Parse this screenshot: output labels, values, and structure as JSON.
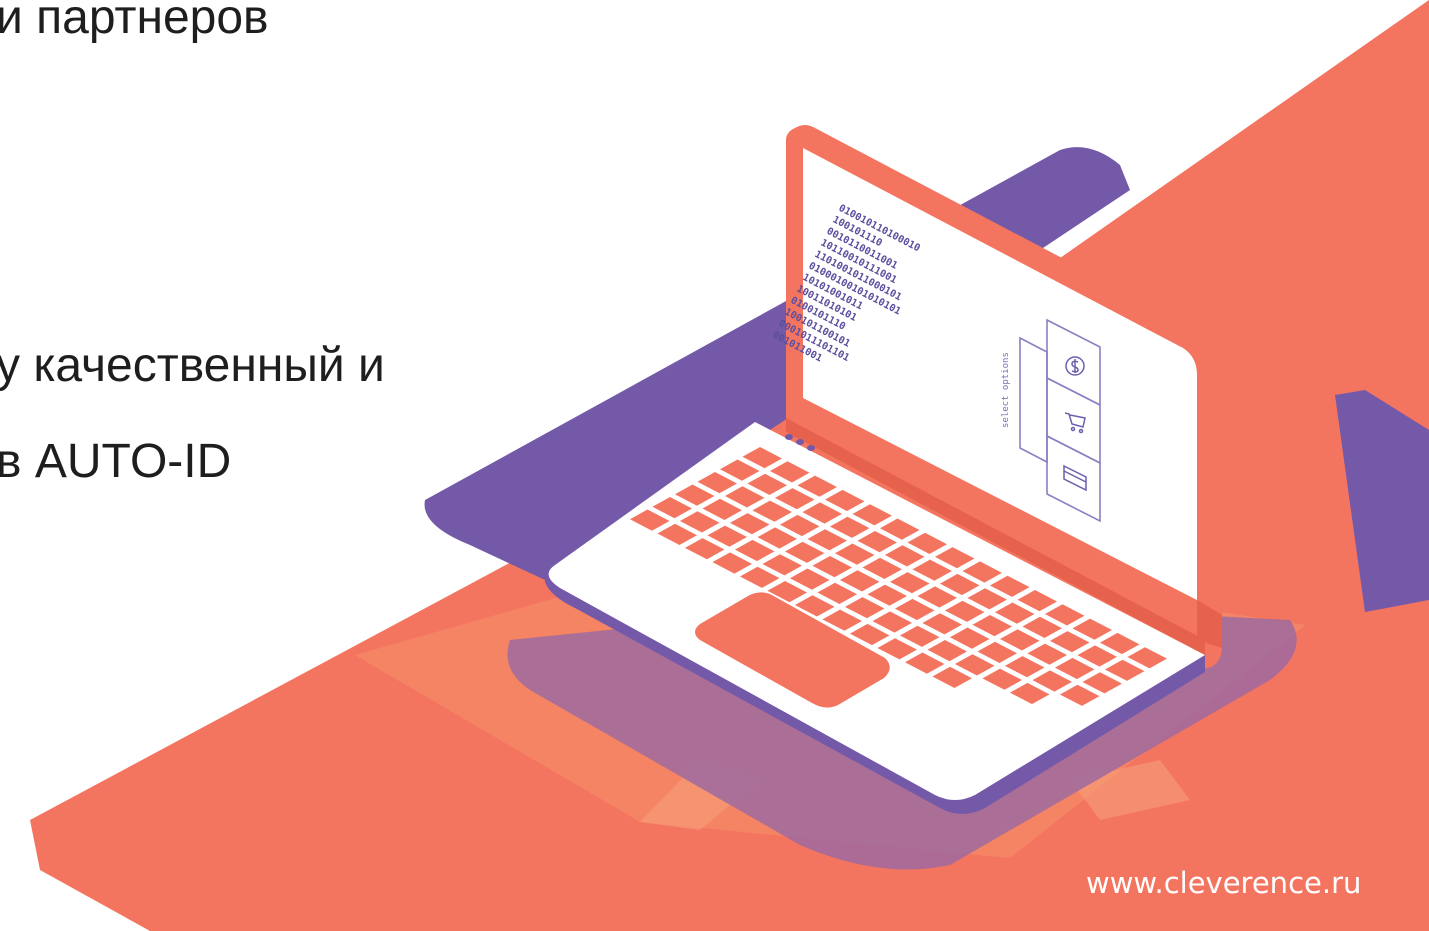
{
  "slide": {
    "text_lines": [
      "и партнеров",
      "у качественный и",
      "в AUTO-ID"
    ],
    "footer_url": "www.cleverence.ru"
  },
  "illustration": {
    "screen": {
      "binary_rows": [
        "010010110100010",
        "100101110",
        "0010110011001",
        "10110010111001",
        "1101001011000101",
        "01000100101010101",
        "10101001011",
        "10011010101",
        "0100101110",
        "100101100101",
        "0001011101101",
        "001011001"
      ],
      "side_label": "select options",
      "option_icons": [
        "dollar-icon",
        "cart-icon",
        "card-icon"
      ]
    }
  },
  "colors": {
    "coral": "#f37560",
    "purple": "#7459a9",
    "text": "#1e1e1e",
    "footer": "#ffffff"
  }
}
